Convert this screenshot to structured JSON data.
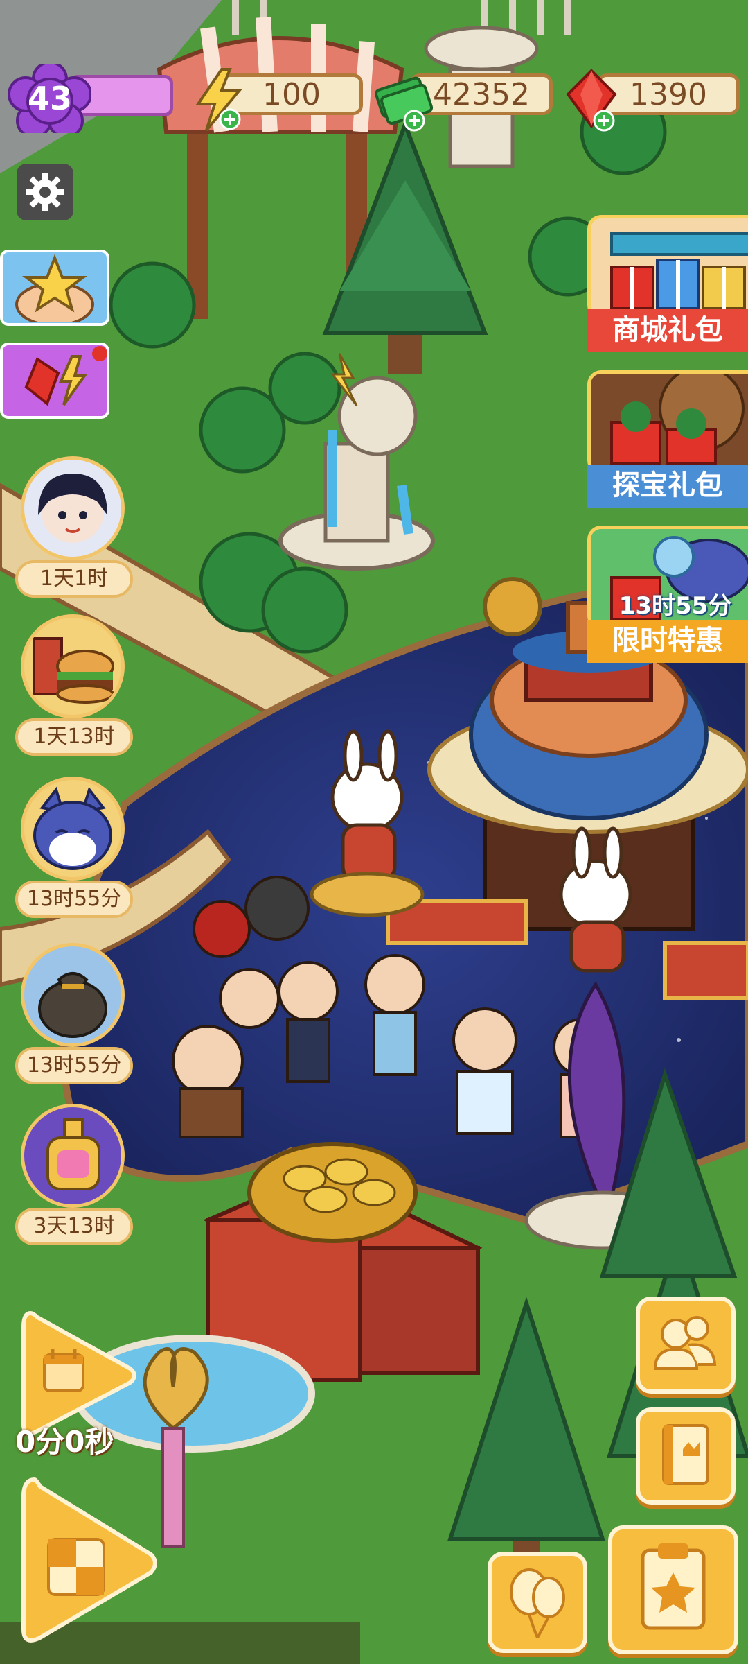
{
  "hud": {
    "level": "43",
    "energy": "100",
    "cash": "42352",
    "gems": "1390"
  },
  "left_timers": [
    {
      "label": "1天1时",
      "icon": "girl-portrait-icon"
    },
    {
      "label": "1天13时",
      "icon": "burger-drink-icon"
    },
    {
      "label": "13时55分",
      "icon": "blue-cat-icon"
    },
    {
      "label": "13时55分",
      "icon": "money-bag-icon"
    },
    {
      "label": "3天13时",
      "icon": "pink-bottle-icon"
    }
  ],
  "gift_packs": [
    {
      "label": "商城礼包",
      "banner_color": "#e8483a"
    },
    {
      "label": "探宝礼包",
      "banner_color": "#4a8fd6"
    },
    {
      "label": "限时特惠",
      "banner_color": "#f3a722",
      "timer": "13时55分"
    }
  ],
  "bottom": {
    "calendar_timer": "0分0秒",
    "buttons": [
      "people-icon",
      "book-icon",
      "balloons-icon",
      "task-clipboard-icon",
      "gameboard-icon"
    ]
  },
  "colors": {
    "grass": "#4f9a3a",
    "water": "#1f2c6e",
    "pill_bg": "#f6e9c8",
    "pill_border": "#b17a3a",
    "level_purple": "#9b47d6",
    "button_orange": "#f7bd3f"
  }
}
